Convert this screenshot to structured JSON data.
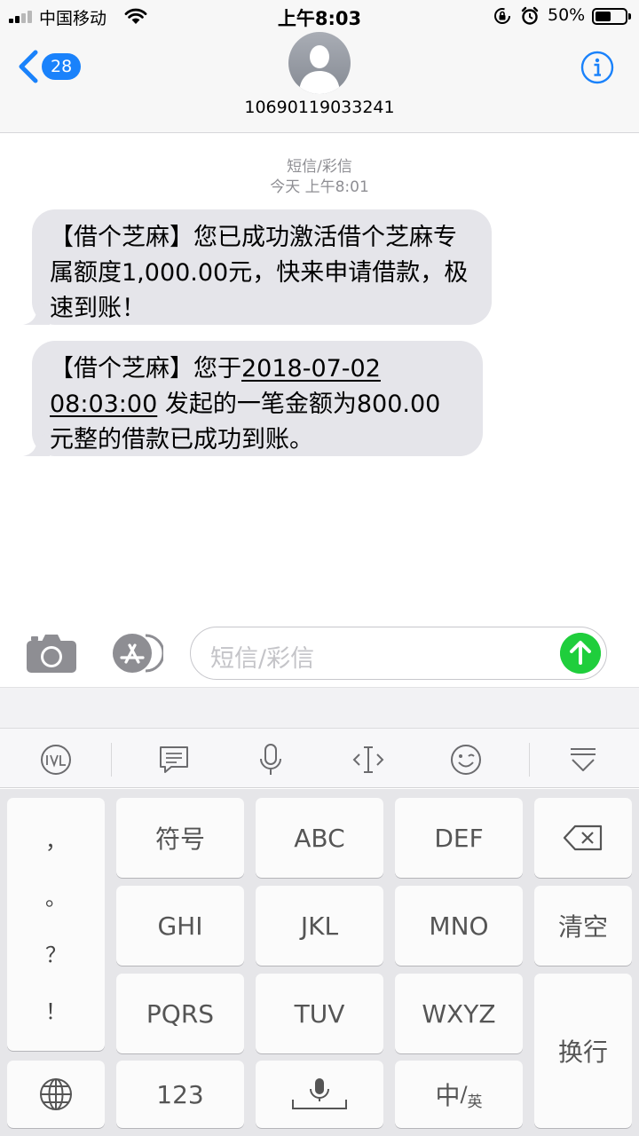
{
  "status_bar": {
    "carrier": "中国移动",
    "time": "上午8:03",
    "battery_percent_text": "50%",
    "battery_level": 0.5
  },
  "header": {
    "back_badge": "28",
    "contact": "10690119033241",
    "icons": [
      "chevron-left-icon",
      "avatar-icon",
      "info-icon"
    ]
  },
  "conversation": {
    "type_label": "短信/彩信",
    "timestamp": "今天 上午8:01",
    "messages": [
      {
        "text": "【借个芝麻】您已成功激活借个芝麻专属额度1,000.00元，快来申请借款，极速到账！"
      },
      {
        "prefix": "【借个芝麻】您于",
        "date_link": "2018-07-02",
        "time_link": "08:03:00",
        "suffix": " 发起的一笔金额为800.00元整的借款已成功到账。"
      }
    ]
  },
  "compose": {
    "placeholder": "短信/彩信",
    "icons": [
      "camera-icon",
      "app-store-icon",
      "send-arrow-icon"
    ]
  },
  "keyboard": {
    "toolbar_icons": [
      "ifly-logo-icon",
      "message-icon",
      "microphone-icon",
      "cursor-icon",
      "emoji-icon",
      "collapse-keyboard-icon"
    ],
    "punctuation": [
      "，",
      "。",
      "？",
      "！"
    ],
    "keys": {
      "symbols": "符号",
      "abc": "ABC",
      "def": "DEF",
      "ghi": "GHI",
      "jkl": "JKL",
      "mno": "MNO",
      "clear": "清空",
      "pqrs": "PQRS",
      "tuv": "TUV",
      "wxyz": "WXYZ",
      "enter": "换行",
      "numbers": "123",
      "lang_main": "中",
      "lang_sep": "/",
      "lang_alt": "英"
    },
    "accent_color": "#1a82fb",
    "send_color": "#1fce3c"
  }
}
